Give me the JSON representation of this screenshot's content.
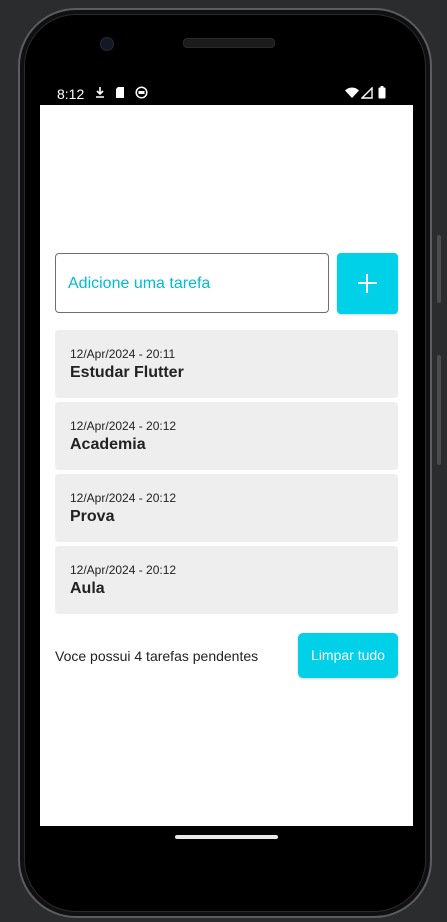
{
  "status_bar": {
    "time": "8:12"
  },
  "input": {
    "placeholder": "Adicione uma tarefa",
    "value": ""
  },
  "add_button": {
    "icon": "plus-icon"
  },
  "tasks": [
    {
      "date": "12/Apr/2024 - 20:11",
      "title": "Estudar Flutter"
    },
    {
      "date": "12/Apr/2024 - 20:12",
      "title": "Academia"
    },
    {
      "date": "12/Apr/2024 - 20:12",
      "title": "Prova"
    },
    {
      "date": "12/Apr/2024 - 20:12",
      "title": "Aula"
    }
  ],
  "footer": {
    "pending_text": "Voce possui 4 tarefas pendentes",
    "clear_label": "Limpar tudo"
  },
  "colors": {
    "accent": "#00d1e8",
    "card": "#eeeeee"
  }
}
